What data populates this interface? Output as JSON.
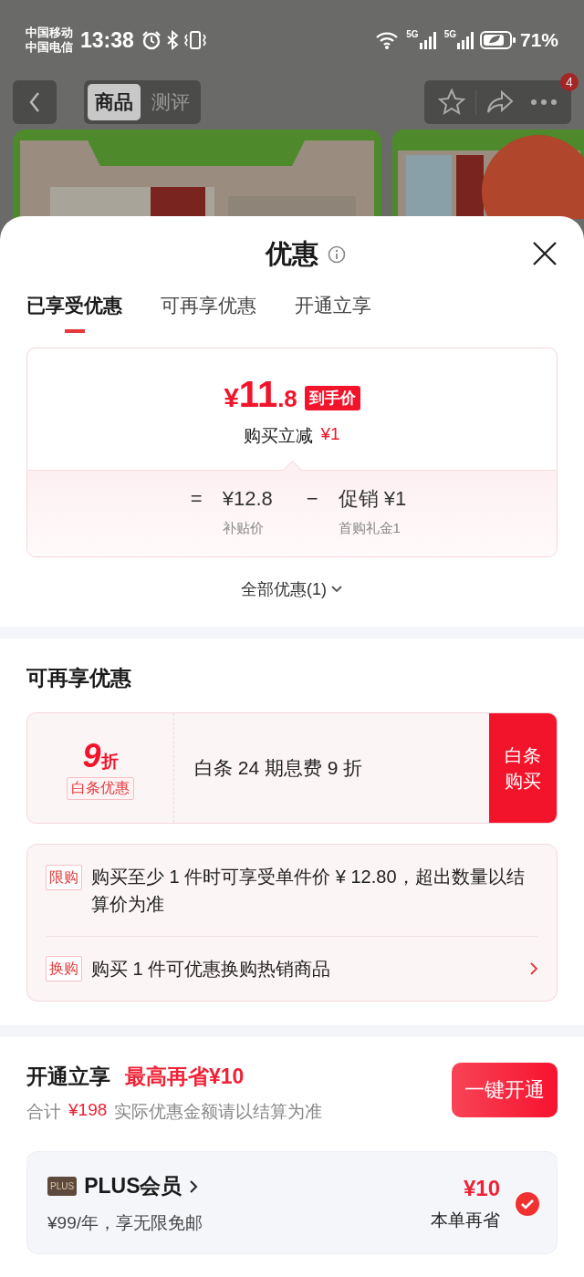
{
  "status_bar": {
    "carriers": [
      "中国移动",
      "中国电信"
    ],
    "time": "13:38",
    "networks": [
      {
        "label": "5G"
      },
      {
        "label": "5G"
      }
    ],
    "battery": "71%"
  },
  "nav": {
    "tabs": [
      {
        "label": "商品",
        "selected": true
      },
      {
        "label": "测评",
        "selected": false
      }
    ],
    "more_badge": "4"
  },
  "sheet": {
    "title": "优惠",
    "tabs": [
      {
        "label": "已享受优惠",
        "selected": true
      },
      {
        "label": "可再享优惠",
        "selected": false
      },
      {
        "label": "开通立享",
        "selected": false
      }
    ],
    "price_card": {
      "price": {
        "currency": "¥",
        "whole": "11",
        "fraction": ".8"
      },
      "price_tag": "到手价",
      "reduction_label": "购买立减",
      "reduction_amount": "¥1",
      "formula": [
        {
          "kind": "operator",
          "text": "="
        },
        {
          "kind": "term",
          "value": "¥12.8",
          "caption": "补贴价"
        },
        {
          "kind": "operator",
          "text": "−"
        },
        {
          "kind": "term",
          "value": "促销 ¥1",
          "caption": "首购礼金1"
        }
      ]
    },
    "all_link": "全部优惠(1)",
    "more_section": {
      "title": "可再享优惠",
      "discount_card": {
        "amount": "9",
        "unit": "折",
        "tag": "白条优惠",
        "description": "白条 24 期息费 9 折",
        "button": "白条购买"
      },
      "rules": [
        {
          "tag": "限购",
          "text": "购买至少 1 件时可享受单件价 ¥ 12.80，超出数量以结算价为准",
          "link": false
        },
        {
          "tag": "换购",
          "text": "购买 1 件可优惠换购热销商品",
          "link": true
        }
      ]
    },
    "open_section": {
      "title": "开通立享",
      "highlight": "最高再省¥10",
      "total_label": "合计",
      "total_amount": "¥198",
      "note": "实际优惠金额请以结算为准",
      "button": "一键开通",
      "memberships": [
        {
          "badge": "PLUS",
          "name": "PLUS会员",
          "price": "¥99/年，享无限免邮",
          "saving": "¥10",
          "saving_label": "本单再省",
          "checked": true
        }
      ]
    }
  }
}
